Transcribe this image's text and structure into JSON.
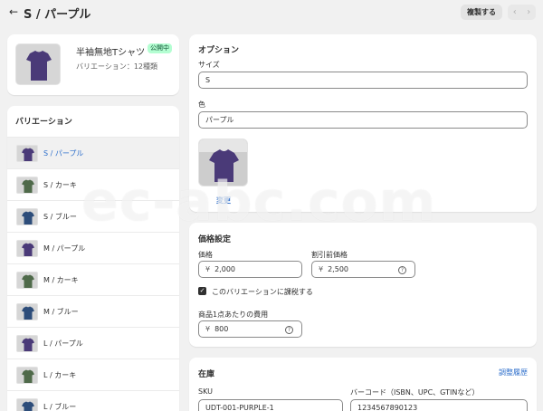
{
  "header": {
    "title": "S / パープル",
    "duplicate_label": "複製する",
    "prev": "‹",
    "next": "›"
  },
  "product": {
    "name": "半袖無地Tシャツ",
    "status": "公開中",
    "variant_count": "バリエーション：12種類"
  },
  "variants": {
    "title": "バリエーション",
    "items": [
      {
        "label": "S / パープル",
        "shirt_color": "#4a3a78"
      },
      {
        "label": "S / カーキ",
        "shirt_color": "#4f6a4a"
      },
      {
        "label": "S / ブルー",
        "shirt_color": "#2d4d7a"
      },
      {
        "label": "M / パープル",
        "shirt_color": "#4a3a78"
      },
      {
        "label": "M / カーキ",
        "shirt_color": "#4f6a4a"
      },
      {
        "label": "M / ブルー",
        "shirt_color": "#2d4d7a"
      },
      {
        "label": "L / パープル",
        "shirt_color": "#4a3a78"
      },
      {
        "label": "L / カーキ",
        "shirt_color": "#4f6a4a"
      },
      {
        "label": "L / ブルー",
        "shirt_color": "#2d4d7a"
      }
    ]
  },
  "options": {
    "title": "オプション",
    "size_label": "サイズ",
    "size_value": "S",
    "color_label": "色",
    "color_value": "パープル",
    "change_label": "変更"
  },
  "pricing": {
    "title": "価格設定",
    "price_label": "価格",
    "price_currency": "¥",
    "price_value": "2,000",
    "compare_label": "割引前価格",
    "compare_currency": "¥",
    "compare_value": "2,500",
    "taxable_label": "このバリエーションに課税する",
    "cost_label": "商品1点あたりの費用",
    "cost_currency": "¥",
    "cost_value": "800"
  },
  "inventory": {
    "title": "在庫",
    "history_label": "調整履歴",
    "sku_label": "SKU",
    "sku_value": "UDT-001-PURPLE-1",
    "barcode_label": "バーコード（ISBN、UPC、GTINなど）",
    "barcode_value": "1234567890123"
  },
  "watermark": "ec-abc.com",
  "colors": {
    "accent_link": "#2c6ecb",
    "badge_bg": "#b4fed2",
    "badge_text": "#0c5132"
  }
}
